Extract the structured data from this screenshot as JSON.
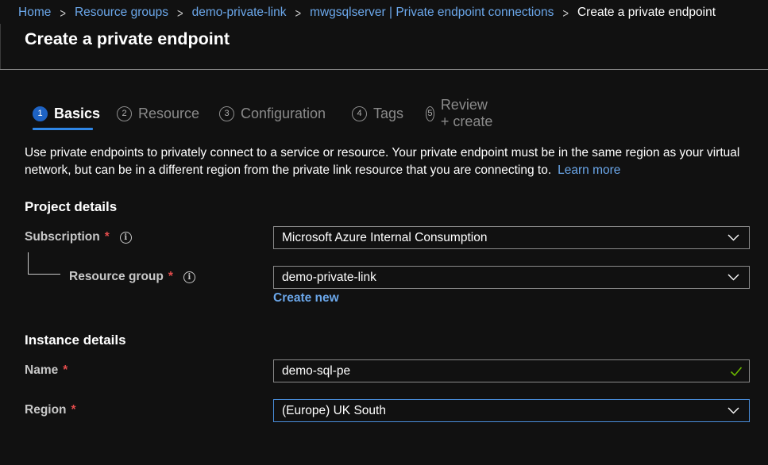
{
  "breadcrumb": {
    "items": [
      "Home",
      "Resource groups",
      "demo-private-link",
      "mwgsqlserver | Private endpoint connections"
    ],
    "current": "Create a private endpoint"
  },
  "page": {
    "title": "Create a private endpoint"
  },
  "tabs": [
    {
      "num": "1",
      "label": "Basics",
      "active": true
    },
    {
      "num": "2",
      "label": "Resource"
    },
    {
      "num": "3",
      "label": "Configuration"
    },
    {
      "num": "4",
      "label": "Tags"
    },
    {
      "num": "5",
      "label": "Review + create"
    }
  ],
  "intro": {
    "text": "Use private endpoints to privately connect to a service or resource. Your private endpoint must be in the same region as your virtual network, but can be in a different region from the private link resource that you are connecting to.",
    "link": "Learn more"
  },
  "project": {
    "heading": "Project details",
    "subscription": {
      "label": "Subscription",
      "required": "*",
      "value": "Microsoft Azure Internal Consumption"
    },
    "resource_group": {
      "label": "Resource group",
      "required": "*",
      "value": "demo-private-link",
      "create_new": "Create new"
    }
  },
  "instance": {
    "heading": "Instance details",
    "name": {
      "label": "Name",
      "required": "*",
      "value": "demo-sql-pe"
    },
    "region": {
      "label": "Region",
      "required": "*",
      "value": "(Europe) UK South"
    }
  },
  "colors": {
    "background": "#111111",
    "link": "#6ba7ea",
    "accent": "#1e63c4",
    "required": "#e34c4c",
    "valid": "#6bb700"
  },
  "icons": [
    "chevron-right-icon",
    "info-icon",
    "chevron-down-icon",
    "checkmark-icon"
  ]
}
